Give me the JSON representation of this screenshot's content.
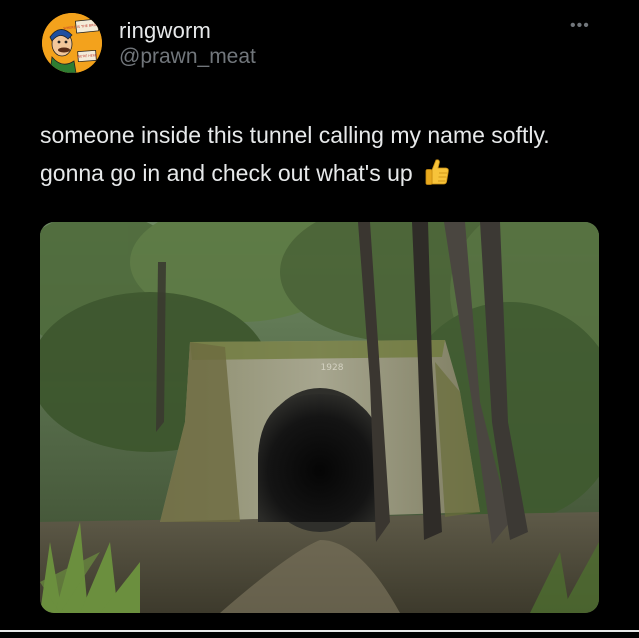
{
  "tweet": {
    "display_name": "ringworm",
    "handle": "@prawn_meat",
    "text": "someone inside this tunnel calling my name softly. gonna go in and check out what's up",
    "emoji": "thumbs-up",
    "more_label": "•••"
  },
  "avatar": {
    "icon": "cartoon-character-avatar",
    "sign_top": "WHERE IS THE BROKE GUY?",
    "sign_bottom": "WE'RE HERE"
  },
  "photo": {
    "description": "concrete tunnel portal in forest",
    "portal_year": "1928"
  },
  "colors": {
    "background": "#000000",
    "primary_text": "#e7e9ea",
    "secondary_text": "#71767b"
  }
}
